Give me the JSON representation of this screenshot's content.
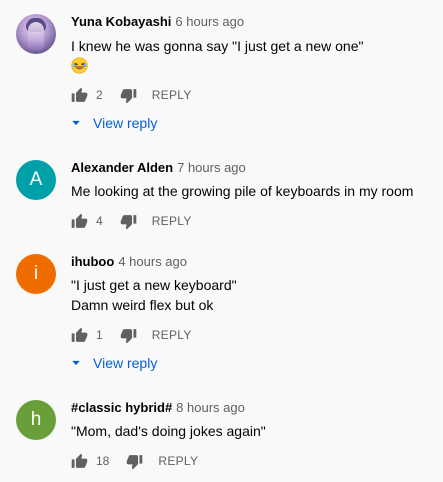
{
  "comments": [
    {
      "author": "Yuna Kobayashi",
      "time": "6 hours ago",
      "text_lines": [
        "I knew he was gonna say \"I just get a new one\""
      ],
      "has_emoji": true,
      "emoji": "laughing-face",
      "likes": "2",
      "reply_label": "REPLY",
      "view_reply_label": "View reply",
      "avatar": {
        "kind": "image"
      }
    },
    {
      "author": "Alexander Alden",
      "time": "7 hours ago",
      "text_lines": [
        "Me looking at the growing pile of keyboards in my room"
      ],
      "likes": "4",
      "reply_label": "REPLY",
      "avatar": {
        "kind": "letter",
        "letter": "A",
        "color": "#00a0a8"
      }
    },
    {
      "author": "ihuboo",
      "time": "4 hours ago",
      "text_lines": [
        "\"I just get a new keyboard\"",
        "Damn weird flex but ok"
      ],
      "likes": "1",
      "reply_label": "REPLY",
      "view_reply_label": "View reply",
      "avatar": {
        "kind": "letter",
        "letter": "i",
        "color": "#ef6c00"
      }
    },
    {
      "author": "#classic hybrid#",
      "time": "8 hours ago",
      "text_lines": [
        "\"Mom, dad's doing jokes again\""
      ],
      "likes": "18",
      "reply_label": "REPLY",
      "avatar": {
        "kind": "letter",
        "letter": "h",
        "color": "#689f38"
      }
    }
  ],
  "colors": {
    "background": "#f9f9f9",
    "link": "#065fd4",
    "secondary_text": "#606060",
    "icon": "#606060"
  }
}
